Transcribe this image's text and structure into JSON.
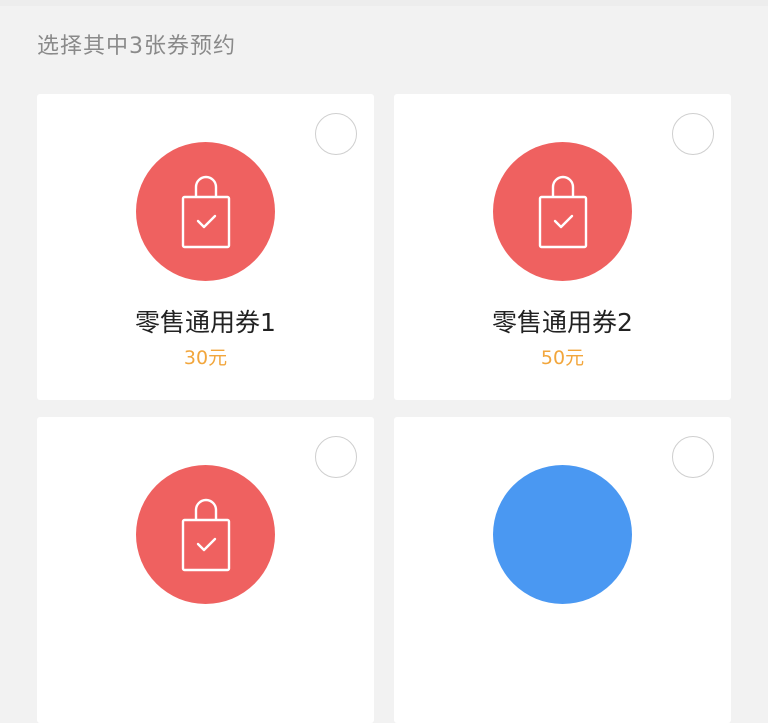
{
  "instruction": "选择其中3张券预约",
  "colors": {
    "background": "#f2f2f2",
    "card": "#ffffff",
    "badge_red": "#ef6160",
    "badge_blue": "#4a98f2",
    "price": "#f2a63c"
  },
  "coupons": [
    {
      "title": "零售通用券1",
      "price": "30元",
      "badge_color": "#ef6160",
      "icon": "shopping-bag-check-icon",
      "selected": false
    },
    {
      "title": "零售通用券2",
      "price": "50元",
      "badge_color": "#ef6160",
      "icon": "shopping-bag-check-icon",
      "selected": false
    },
    {
      "title": "",
      "price": "",
      "badge_color": "#ef6160",
      "icon": "shopping-bag-check-icon",
      "selected": false
    },
    {
      "title": "",
      "price": "",
      "badge_color": "#4a98f2",
      "icon": "",
      "selected": false
    }
  ]
}
